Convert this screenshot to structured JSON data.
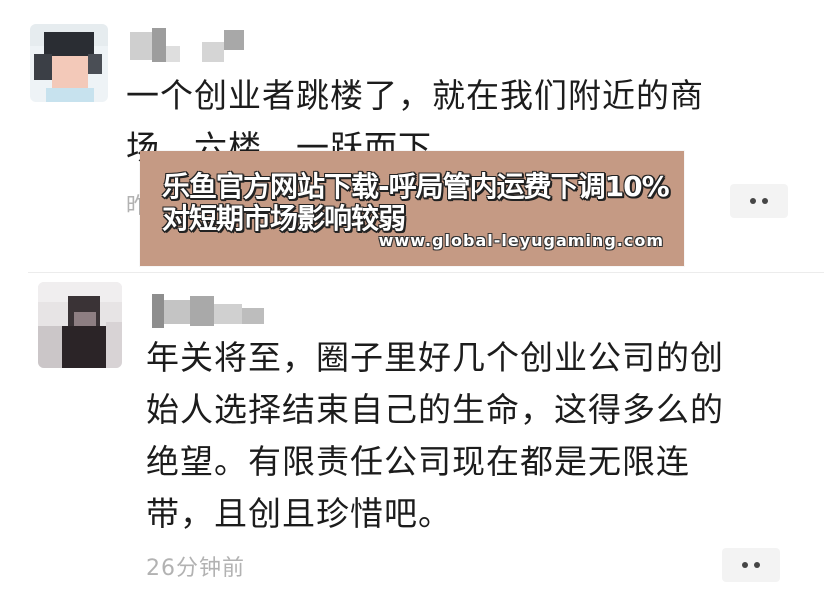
{
  "comments": [
    {
      "text": "一个创业者跳楼了，就在我们附近的商\n场。六楼，一跃而下。",
      "time": "昨"
    },
    {
      "text": "年关将至，圈子里好几个创业公司的创\n始人选择结束自己的生命，这得多么的\n绝望。有限责任公司现在都是无限连\n带，且创且珍惜吧。",
      "time": "26分钟前"
    }
  ],
  "overlay": {
    "title": "乐鱼官方网站下载-呼局管内运费下调10%对短期市场影响较弱",
    "url": "www.global-leyugaming.com"
  },
  "colors": {
    "overlay_bg": "#c59a84",
    "timestamp": "#b2b2b2",
    "more_button_bg": "#f3f3f3"
  }
}
